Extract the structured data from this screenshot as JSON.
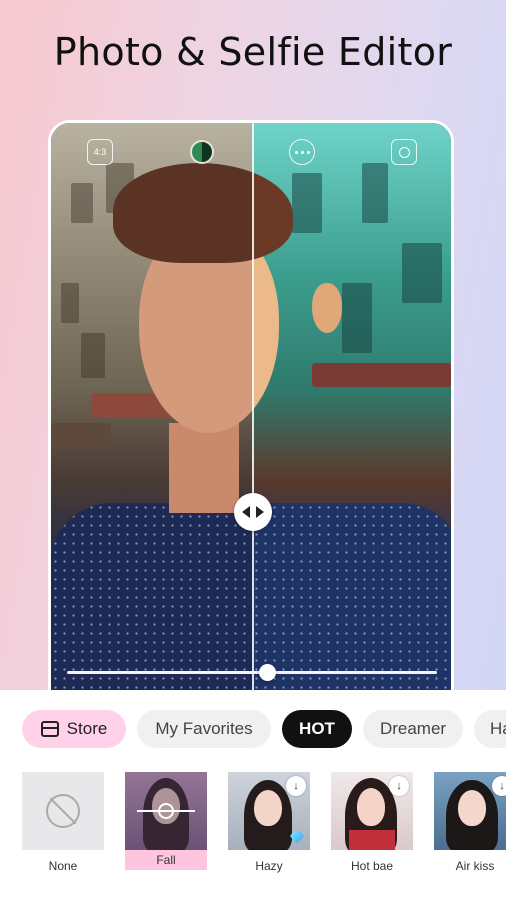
{
  "headline": "Photo & Selfie Editor",
  "preview": {
    "top_left_icon": "4:3",
    "compare_handle": "compare-arrows-icon",
    "slider_value": 0.57
  },
  "tabs": [
    {
      "label": "Store",
      "icon": "store-icon"
    },
    {
      "label": "My Favorites"
    },
    {
      "label": "HOT",
      "active": true
    },
    {
      "label": "Dreamer"
    },
    {
      "label": "Ha"
    }
  ],
  "filters": [
    {
      "label": "None",
      "icon": "none-icon"
    },
    {
      "label": "Fall",
      "selected": true
    },
    {
      "label": "Hazy",
      "download": "↓",
      "premium": true
    },
    {
      "label": "Hot bae",
      "download": "↓"
    },
    {
      "label": "Air kiss",
      "download": "↓"
    }
  ],
  "colors": {
    "accent_pink": "#ffd2ea",
    "selected_label": "#ffc4de",
    "active_tab": "#111111"
  }
}
